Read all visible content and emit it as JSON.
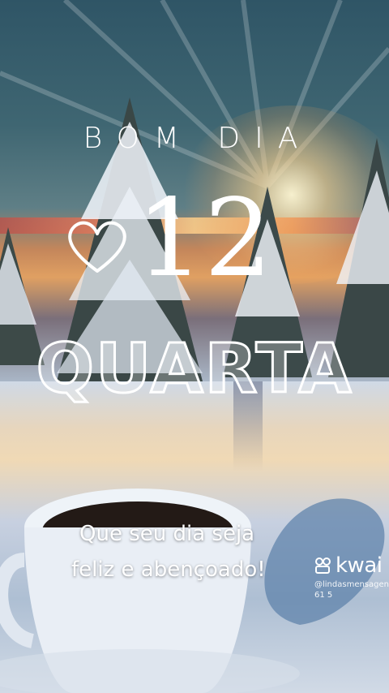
{
  "greeting": "BOM DIA",
  "day_number": "12",
  "weekday": "QUARTA",
  "message": {
    "line1": "Que seu dia seja",
    "line2": "feliz e abençoado!"
  },
  "watermark": {
    "brand": "kwai",
    "handle": "@lindasmensagen61 5"
  },
  "icons": [
    "heart-outline-icon",
    "kwai-logo-icon"
  ],
  "colors": {
    "text": "#ffffff",
    "sky_top": "#2f5566",
    "sunset": "#e0a062",
    "snow": "#cfd9e6"
  }
}
